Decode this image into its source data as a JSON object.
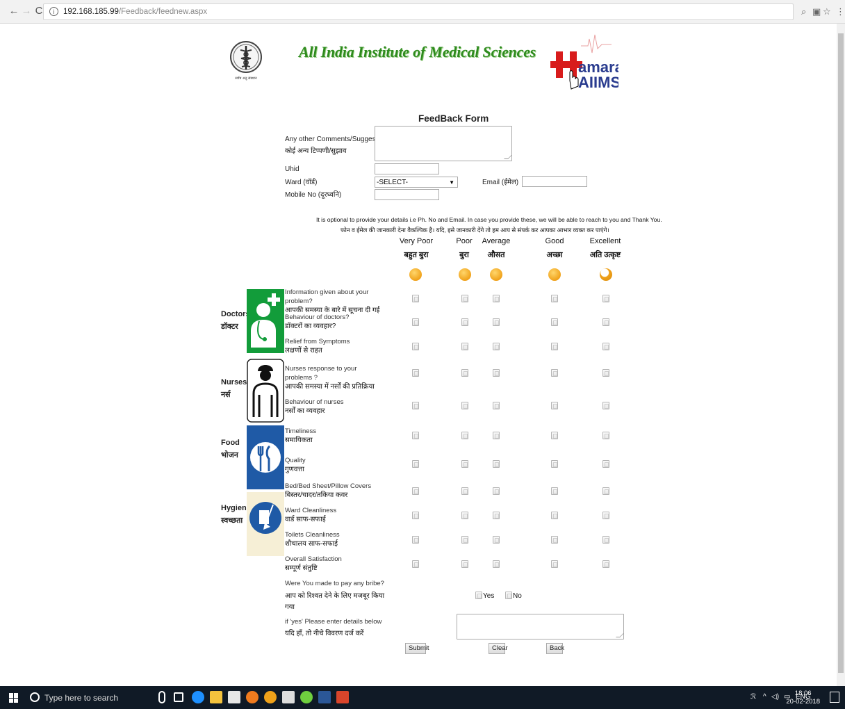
{
  "browser": {
    "url_host": "192.168.185.99",
    "url_path": "/Feedback/feednew.aspx"
  },
  "header": {
    "title": "All India Institute of Medical Sciences",
    "logo_left_caption": "सर्वत्र अनु संस्थान",
    "logo_right_top": "amara",
    "logo_right_bottom": "AIIMS"
  },
  "form": {
    "title": "FeedBack Form",
    "comments_label_en": "Any other Comments/Suggestions",
    "comments_label_hi": "कोई अन्य टिप्पणी/सुझाव",
    "uhid_label": "Uhid",
    "ward_label": "Ward (वॉर्ड)",
    "ward_selected": "-SELECT-",
    "email_label": "Email (ईमेल)",
    "mobile_label": "Mobile No (दूरध्वनि)",
    "note_en": "It is optional to provide your details i.e Ph. No and Email. In case you provide these, we will be able to reach to you and Thank You.",
    "note_hi": "फोन व ईमेल की जानकारी देना वैकल्पिक है। यदि, इसे जानकारी देंगे तो हम आप से संपर्क कर आपका आभार व्यक्त कर पाएंगे।"
  },
  "ratings": [
    {
      "en": "Very Poor",
      "hi": "बहुत बुरा"
    },
    {
      "en": "Poor",
      "hi": "बुरा"
    },
    {
      "en": "Average",
      "hi": "औसत"
    },
    {
      "en": "Good",
      "hi": "अच्छा"
    },
    {
      "en": "Excellent",
      "hi": "अति उत्कृष्ट"
    }
  ],
  "categories": [
    {
      "en": "Doctors",
      "hi": "डॉक्टर"
    },
    {
      "en": "Nurses",
      "hi": "नर्स"
    },
    {
      "en": "Food",
      "hi": "भोजन"
    },
    {
      "en": "Hygiene",
      "hi": "स्वच्छता"
    }
  ],
  "questions": [
    {
      "en": "Information given about your problem?",
      "hi": "आपकी समस्या के बारे में सूचना दी गई"
    },
    {
      "en": "Behaviour of doctors?",
      "hi": "डॉक्टरों का व्यवहार?"
    },
    {
      "en": "Relief from Symptoms",
      "hi": "लक्षणों से राहत"
    },
    {
      "en": "Nurses response to your problems ?",
      "hi": "आपकी समस्या में नर्सों की प्रतिक्रिया"
    },
    {
      "en": "Behaviour of nurses",
      "hi": "नर्सों का व्यवहार"
    },
    {
      "en": "Timeliness",
      "hi": "समायिकता"
    },
    {
      "en": "Quality",
      "hi": "गुणवत्ता"
    },
    {
      "en": "Bed/Bed Sheet/Pillow Covers",
      "hi": "बिस्तर/चादर/तकिया कवर"
    },
    {
      "en": "Ward Cleanliness",
      "hi": "वार्ड साफ-सफाई"
    },
    {
      "en": "Toilets Cleanliness",
      "hi": "शौचालय साफ-सफाई"
    },
    {
      "en": "Overall Satisfaction",
      "hi": "सम्पूर्ण संतुष्टि"
    }
  ],
  "bribe": {
    "question_en": "Were You made to pay any bribe?",
    "question_hi": "आप को रिश्वत देने के लिए मजबूर किया गया",
    "yes": "Yes",
    "no": "No",
    "details_en": "if 'yes' Please enter details below",
    "details_hi": "यदि हाँ, तो नीचे विवरण दर्ज करें"
  },
  "buttons": {
    "submit": "Submit",
    "clear": "Clear",
    "back": "Back"
  },
  "taskbar": {
    "search_placeholder": "Type here to search",
    "lang": "ENG",
    "time": "18:06",
    "date": "20-02-2018"
  }
}
